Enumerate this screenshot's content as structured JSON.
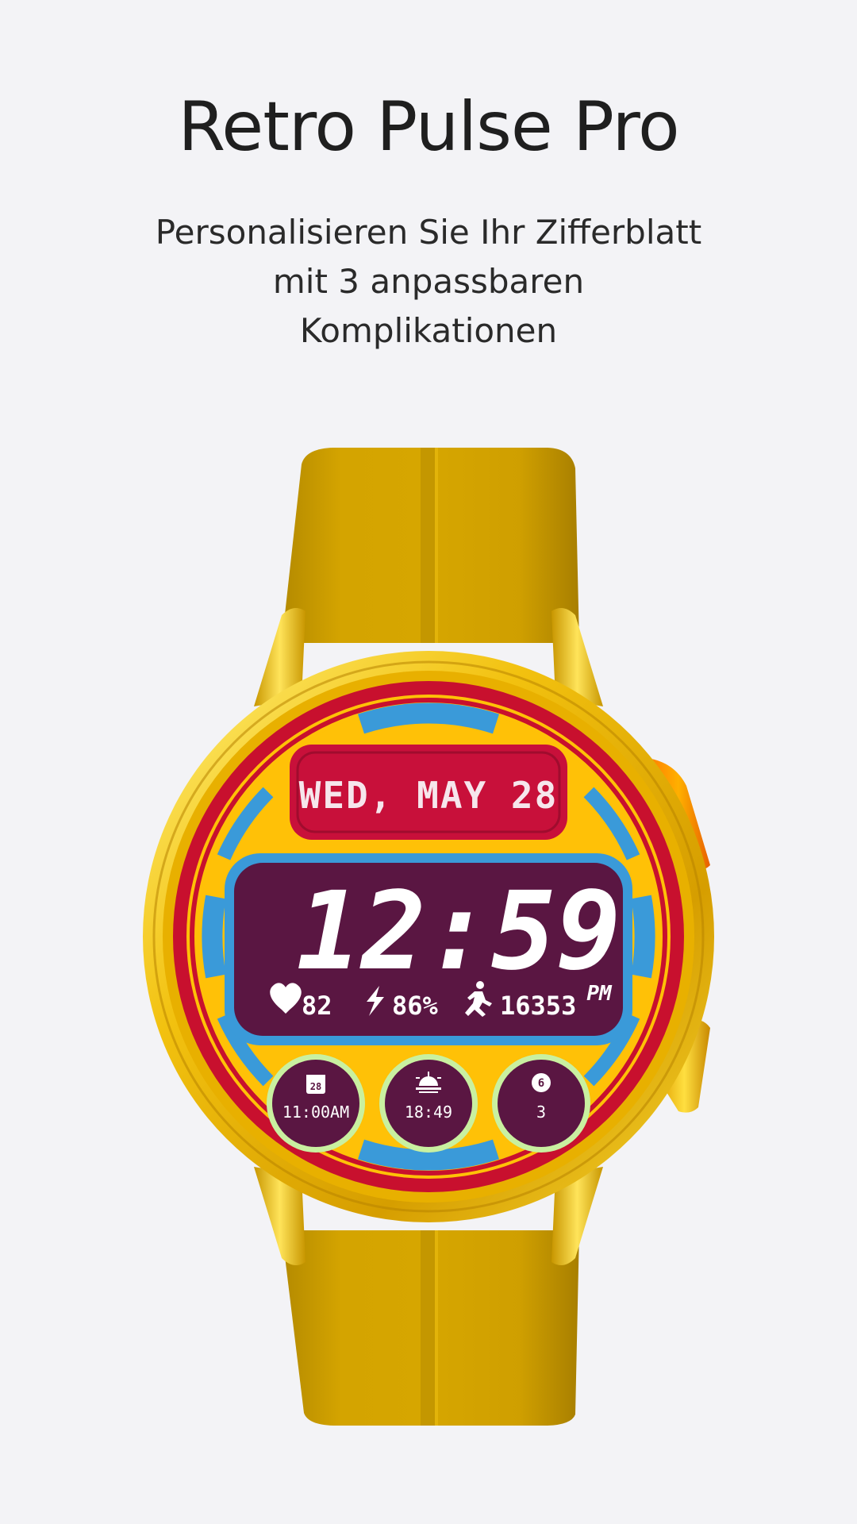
{
  "title": "Retro Pulse Pro",
  "subtitle": "Personalisieren Sie Ihr Zifferblatt mit 3 anpassbaren Komplikationen",
  "watch": {
    "date": "WED, MAY 28",
    "time": "12:59",
    "ampm": "PM",
    "heart_rate": "82",
    "battery": "86%",
    "steps": "16353",
    "complications": [
      {
        "icon": "calendar-icon",
        "badge": "28",
        "value": "11:00AM"
      },
      {
        "icon": "sunrise-icon",
        "value": "18:49"
      },
      {
        "icon": "notification-icon",
        "badge": "6",
        "value": "3"
      }
    ]
  },
  "colors": {
    "background": "#f3f3f6",
    "strap": "#d1a200",
    "case_gold": "#f2c10f",
    "dial_yellow": "#ffc107",
    "ring_red": "#c8102e",
    "accent_blue": "#3a9ad9",
    "screen_purple": "#5a1642",
    "complication_ring": "#c9f0a0"
  }
}
